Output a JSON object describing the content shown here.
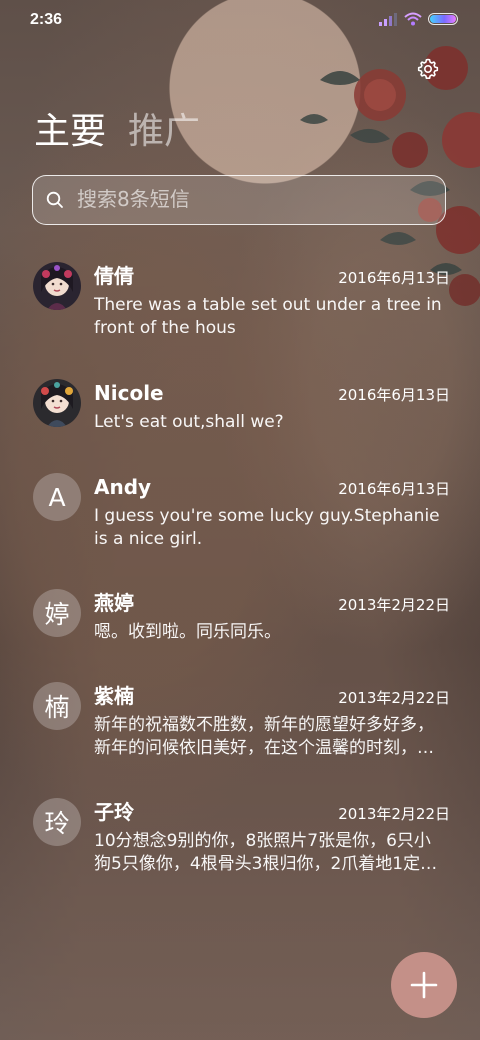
{
  "status_bar": {
    "time": "2:36",
    "battery_level": 1.0,
    "icons": [
      "signal-icon",
      "wifi-icon",
      "battery-icon"
    ]
  },
  "header": {
    "settings_icon": "gear-icon",
    "tabs": [
      {
        "label": "主要",
        "active": true
      },
      {
        "label": "推广",
        "active": false
      }
    ]
  },
  "search": {
    "placeholder": "搜索8条短信",
    "value": "",
    "icon": "search-icon"
  },
  "conversations": [
    {
      "avatar_type": "photo",
      "avatar_letter": "",
      "name": "倩倩",
      "date": "2016年6月13日",
      "preview": "There was a table set out under a tree in front of the hous"
    },
    {
      "avatar_type": "photo",
      "avatar_letter": "",
      "name": "Nicole",
      "date": "2016年6月13日",
      "preview": "Let's eat out,shall we?"
    },
    {
      "avatar_type": "letter",
      "avatar_letter": "A",
      "name": "Andy",
      "date": "2016年6月13日",
      "preview": "I guess you're some lucky guy.Stephanie is a nice girl."
    },
    {
      "avatar_type": "letter",
      "avatar_letter": "婷",
      "name": "燕婷",
      "date": "2013年2月22日",
      "preview": "嗯。收到啦。同乐同乐。"
    },
    {
      "avatar_type": "letter",
      "avatar_letter": "楠",
      "name": "紫楠",
      "date": "2013年2月22日",
      "preview": "新年的祝福数不胜数，新年的愿望好多好多，新年的问候依旧美好，在这个温馨的时刻，…"
    },
    {
      "avatar_type": "letter",
      "avatar_letter": "玲",
      "name": "子玲",
      "date": "2013年2月22日",
      "preview": "10分想念9别的你，8张照片7张是你，6只小狗5只像你，4根骨头3根归你，2爪着地1定是…"
    }
  ],
  "fab": {
    "icon": "plus-icon",
    "color": "#c49088"
  },
  "colors": {
    "battery_gradient": [
      "#45d2ff",
      "#7a6bff",
      "#e77cff"
    ],
    "signal_active": "#c9a0ff",
    "wifi": "#d7a0ff"
  }
}
